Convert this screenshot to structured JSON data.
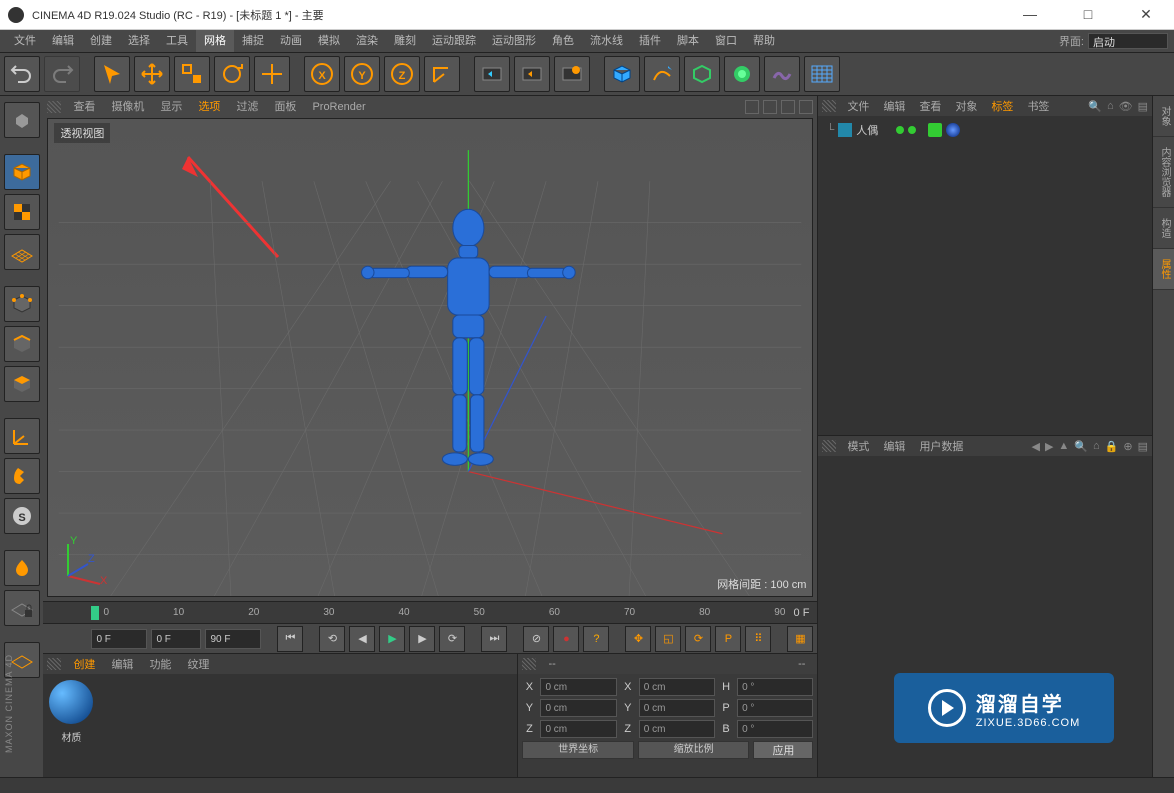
{
  "window": {
    "title": "CINEMA 4D R19.024 Studio (RC - R19) - [未标题 1 *] - 主要",
    "min": "—",
    "max": "□",
    "close": "✕"
  },
  "menubar": {
    "items": [
      "文件",
      "编辑",
      "创建",
      "选择",
      "工具",
      "网格",
      "捕捉",
      "动画",
      "模拟",
      "渲染",
      "雕刻",
      "运动跟踪",
      "运动图形",
      "角色",
      "流水线",
      "插件",
      "脚本",
      "窗口",
      "帮助"
    ],
    "highlight_index": 5,
    "ui_label": "界面:",
    "ui_value": "启动"
  },
  "viewport_menu": {
    "items": [
      "查看",
      "摄像机",
      "显示",
      "选项",
      "过滤",
      "面板",
      "ProRender"
    ],
    "highlight_index": 3
  },
  "viewport": {
    "label": "透视视图",
    "grid_info": "网格间距 : 100 cm",
    "axis_x": "X",
    "axis_y": "Y",
    "axis_z": "Z"
  },
  "timeline": {
    "ticks": [
      "0",
      "10",
      "20",
      "30",
      "40",
      "50",
      "60",
      "70",
      "80",
      "90"
    ],
    "current": "0 F"
  },
  "playback": {
    "start": "0 F",
    "cursor": "0 F",
    "end": "90 F"
  },
  "material_panel": {
    "tabs": [
      "创建",
      "编辑",
      "功能",
      "纹理"
    ],
    "highlight_index": 0,
    "item_label": "材质"
  },
  "coord_panel": {
    "tabs_left": "--",
    "tabs_right": "--",
    "rows": [
      {
        "axis": "X",
        "pos": "0 cm",
        "size": "0 cm",
        "rot_axis": "H",
        "rot": "0 °"
      },
      {
        "axis": "Y",
        "pos": "0 cm",
        "size": "0 cm",
        "rot_axis": "P",
        "rot": "0 °"
      },
      {
        "axis": "Z",
        "pos": "0 cm",
        "size": "0 cm",
        "rot_axis": "B",
        "rot": "0 °"
      }
    ],
    "sel1": "世界坐标",
    "sel2": "缩放比例",
    "apply": "应用"
  },
  "object_panel": {
    "tabs": [
      "文件",
      "编辑",
      "查看",
      "对象",
      "标签",
      "书签"
    ],
    "highlight_index": 4,
    "item_name": "人偶"
  },
  "attr_panel": {
    "tabs": [
      "模式",
      "编辑",
      "用户数据"
    ]
  },
  "right_tabs": [
    "对象",
    "内容浏览器",
    "构造",
    "属性"
  ],
  "watermark": {
    "big": "溜溜自学",
    "small": "ZIXUE.3D66.COM"
  },
  "maxon": "MAXON  CINEMA 4D"
}
